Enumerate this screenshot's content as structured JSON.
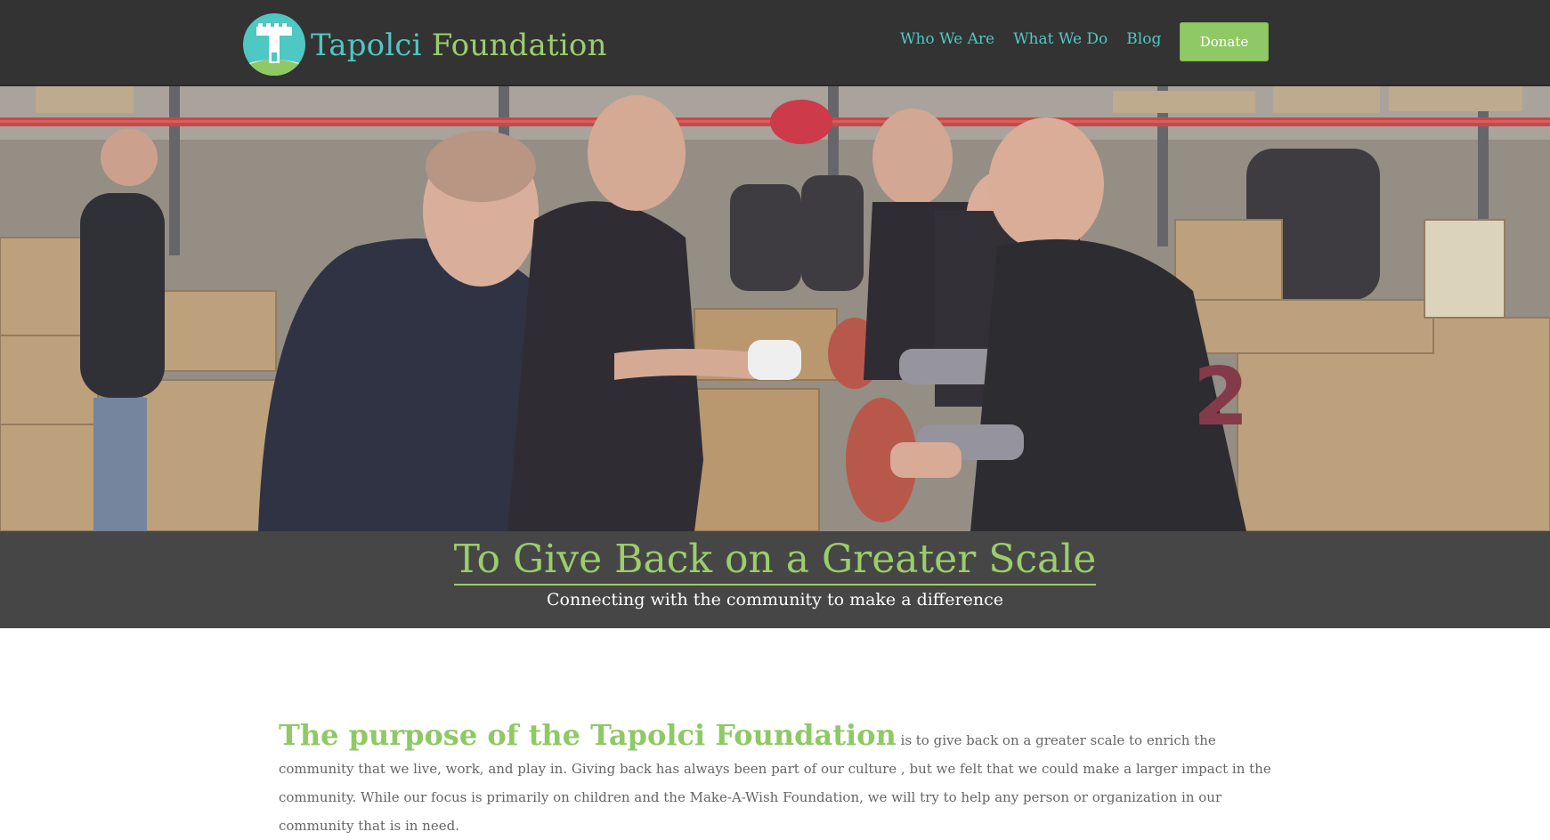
{
  "header": {
    "logo": {
      "word1": "Tapolci",
      "word2": "Foundation",
      "icon": "tower-logo-icon"
    },
    "nav": [
      {
        "label": "Who We Are"
      },
      {
        "label": "What We Do"
      },
      {
        "label": "Blog"
      }
    ],
    "donate_label": "Donate"
  },
  "hero": {
    "image": "volunteers-packing-food-boxes-photo",
    "title": "To Give Back on a Greater Scale",
    "subtitle": "Connecting with the community to make a difference"
  },
  "main": {
    "lead": "The purpose of the Tapolci Foundation",
    "body": " is to give back on a greater scale to enrich the community that we live, work, and play in. Giving back has always been part of our culture , but we felt that we could make a larger impact in the community. While our focus is primarily on children and the Make-A-Wish Foundation, we will try to help any person or organization in our community that is in need."
  },
  "colors": {
    "header_bg": "#333333",
    "accent_teal": "#4fc7c3",
    "accent_green": "#9bce6b",
    "donate_bg": "#8fc965",
    "banner_bg": "#464646"
  }
}
